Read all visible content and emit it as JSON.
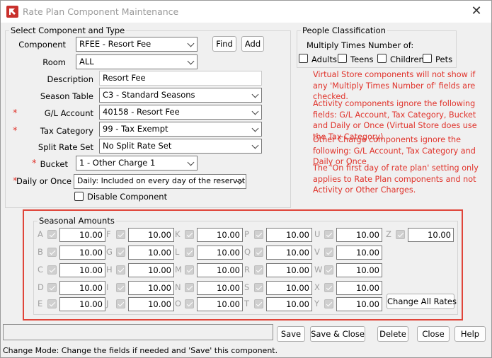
{
  "window": {
    "title": "Rate Plan Component Maintenance",
    "close_glyph": "✕"
  },
  "select_group": {
    "legend": "Select Component  and  Type",
    "component": {
      "label": "Component",
      "value": "RFEE - Resort Fee"
    },
    "room": {
      "label": "Room",
      "value": "ALL"
    },
    "description": {
      "label": "Description",
      "value": "Resort Fee"
    },
    "season_table": {
      "label": "Season Table",
      "value": "C3 - Standard Seasons"
    },
    "gl_account": {
      "label": "G/L Account",
      "value": "40158 - Resort Fee"
    },
    "tax_category": {
      "label": "Tax Category",
      "value": "99 - Tax Exempt"
    },
    "split_rate_set": {
      "label": "Split Rate Set",
      "value": "No Split Rate Set"
    },
    "bucket": {
      "label": "Bucket",
      "value": "1 - Other Charge 1"
    },
    "daily_or_once": {
      "label": "Daily or Once",
      "value": "Daily: Included on every day of the reservation"
    },
    "disable_component": {
      "label": "Disable Component",
      "checked": false
    },
    "required_marker": "*",
    "find_label": "Find",
    "add_label": "Add"
  },
  "people": {
    "legend": "People Classification",
    "multiply_label": "Multiply Times Number of:",
    "options": [
      {
        "label": "Adults",
        "checked": false
      },
      {
        "label": "Teens",
        "checked": false
      },
      {
        "label": "Children",
        "checked": false
      },
      {
        "label": "Pets",
        "checked": false
      }
    ]
  },
  "info_notes": [
    "Virtual Store components will not show if any 'Multiply Times Number of' fields are checked.",
    "Activity components ignore the following fields: G/L Account, Tax Category, Bucket and Daily or Once (Virtual Store does use the Tax Category)",
    "Other Charge components ignore the following: G/L Account, Tax Category and Daily or Once",
    "The 'On first day of rate plan' setting only applies to Rate Plan components and not Activity or Other Charges."
  ],
  "seasonal": {
    "legend": "Seasonal Amounts",
    "columns": [
      [
        {
          "letter": "A",
          "value": "10.00"
        },
        {
          "letter": "B",
          "value": "10.00"
        },
        {
          "letter": "C",
          "value": "10.00"
        },
        {
          "letter": "D",
          "value": "10.00"
        },
        {
          "letter": "E",
          "value": "10.00"
        }
      ],
      [
        {
          "letter": "F",
          "value": "10.00"
        },
        {
          "letter": "G",
          "value": "10.00"
        },
        {
          "letter": "H",
          "value": "10.00"
        },
        {
          "letter": "I",
          "value": "10.00"
        },
        {
          "letter": "J",
          "value": "10.00"
        }
      ],
      [
        {
          "letter": "K",
          "value": "10.00"
        },
        {
          "letter": "L",
          "value": "10.00"
        },
        {
          "letter": "M",
          "value": "10.00"
        },
        {
          "letter": "N",
          "value": "10.00"
        },
        {
          "letter": "O",
          "value": "10.00"
        }
      ],
      [
        {
          "letter": "P",
          "value": "10.00"
        },
        {
          "letter": "Q",
          "value": "10.00"
        },
        {
          "letter": "R",
          "value": "10.00"
        },
        {
          "letter": "S",
          "value": "10.00"
        },
        {
          "letter": "T",
          "value": "10.00"
        }
      ],
      [
        {
          "letter": "U",
          "value": "10.00"
        },
        {
          "letter": "V",
          "value": "10.00"
        },
        {
          "letter": "W",
          "value": "10.00"
        },
        {
          "letter": "X",
          "value": "10.00"
        },
        {
          "letter": "Y",
          "value": "10.00"
        }
      ],
      [
        {
          "letter": "Z",
          "value": "10.00"
        }
      ]
    ],
    "change_all_label": "Change All Rates"
  },
  "actions": {
    "save": "Save",
    "save_close": "Save & Close",
    "delete": "Delete",
    "close": "Close",
    "help": "Help"
  },
  "status": "Change Mode: Change the fields if needed and 'Save' this component.",
  "colors": {
    "required": "#e0332b",
    "highlight_border": "#e0453a",
    "info_text": "#e0332b"
  }
}
